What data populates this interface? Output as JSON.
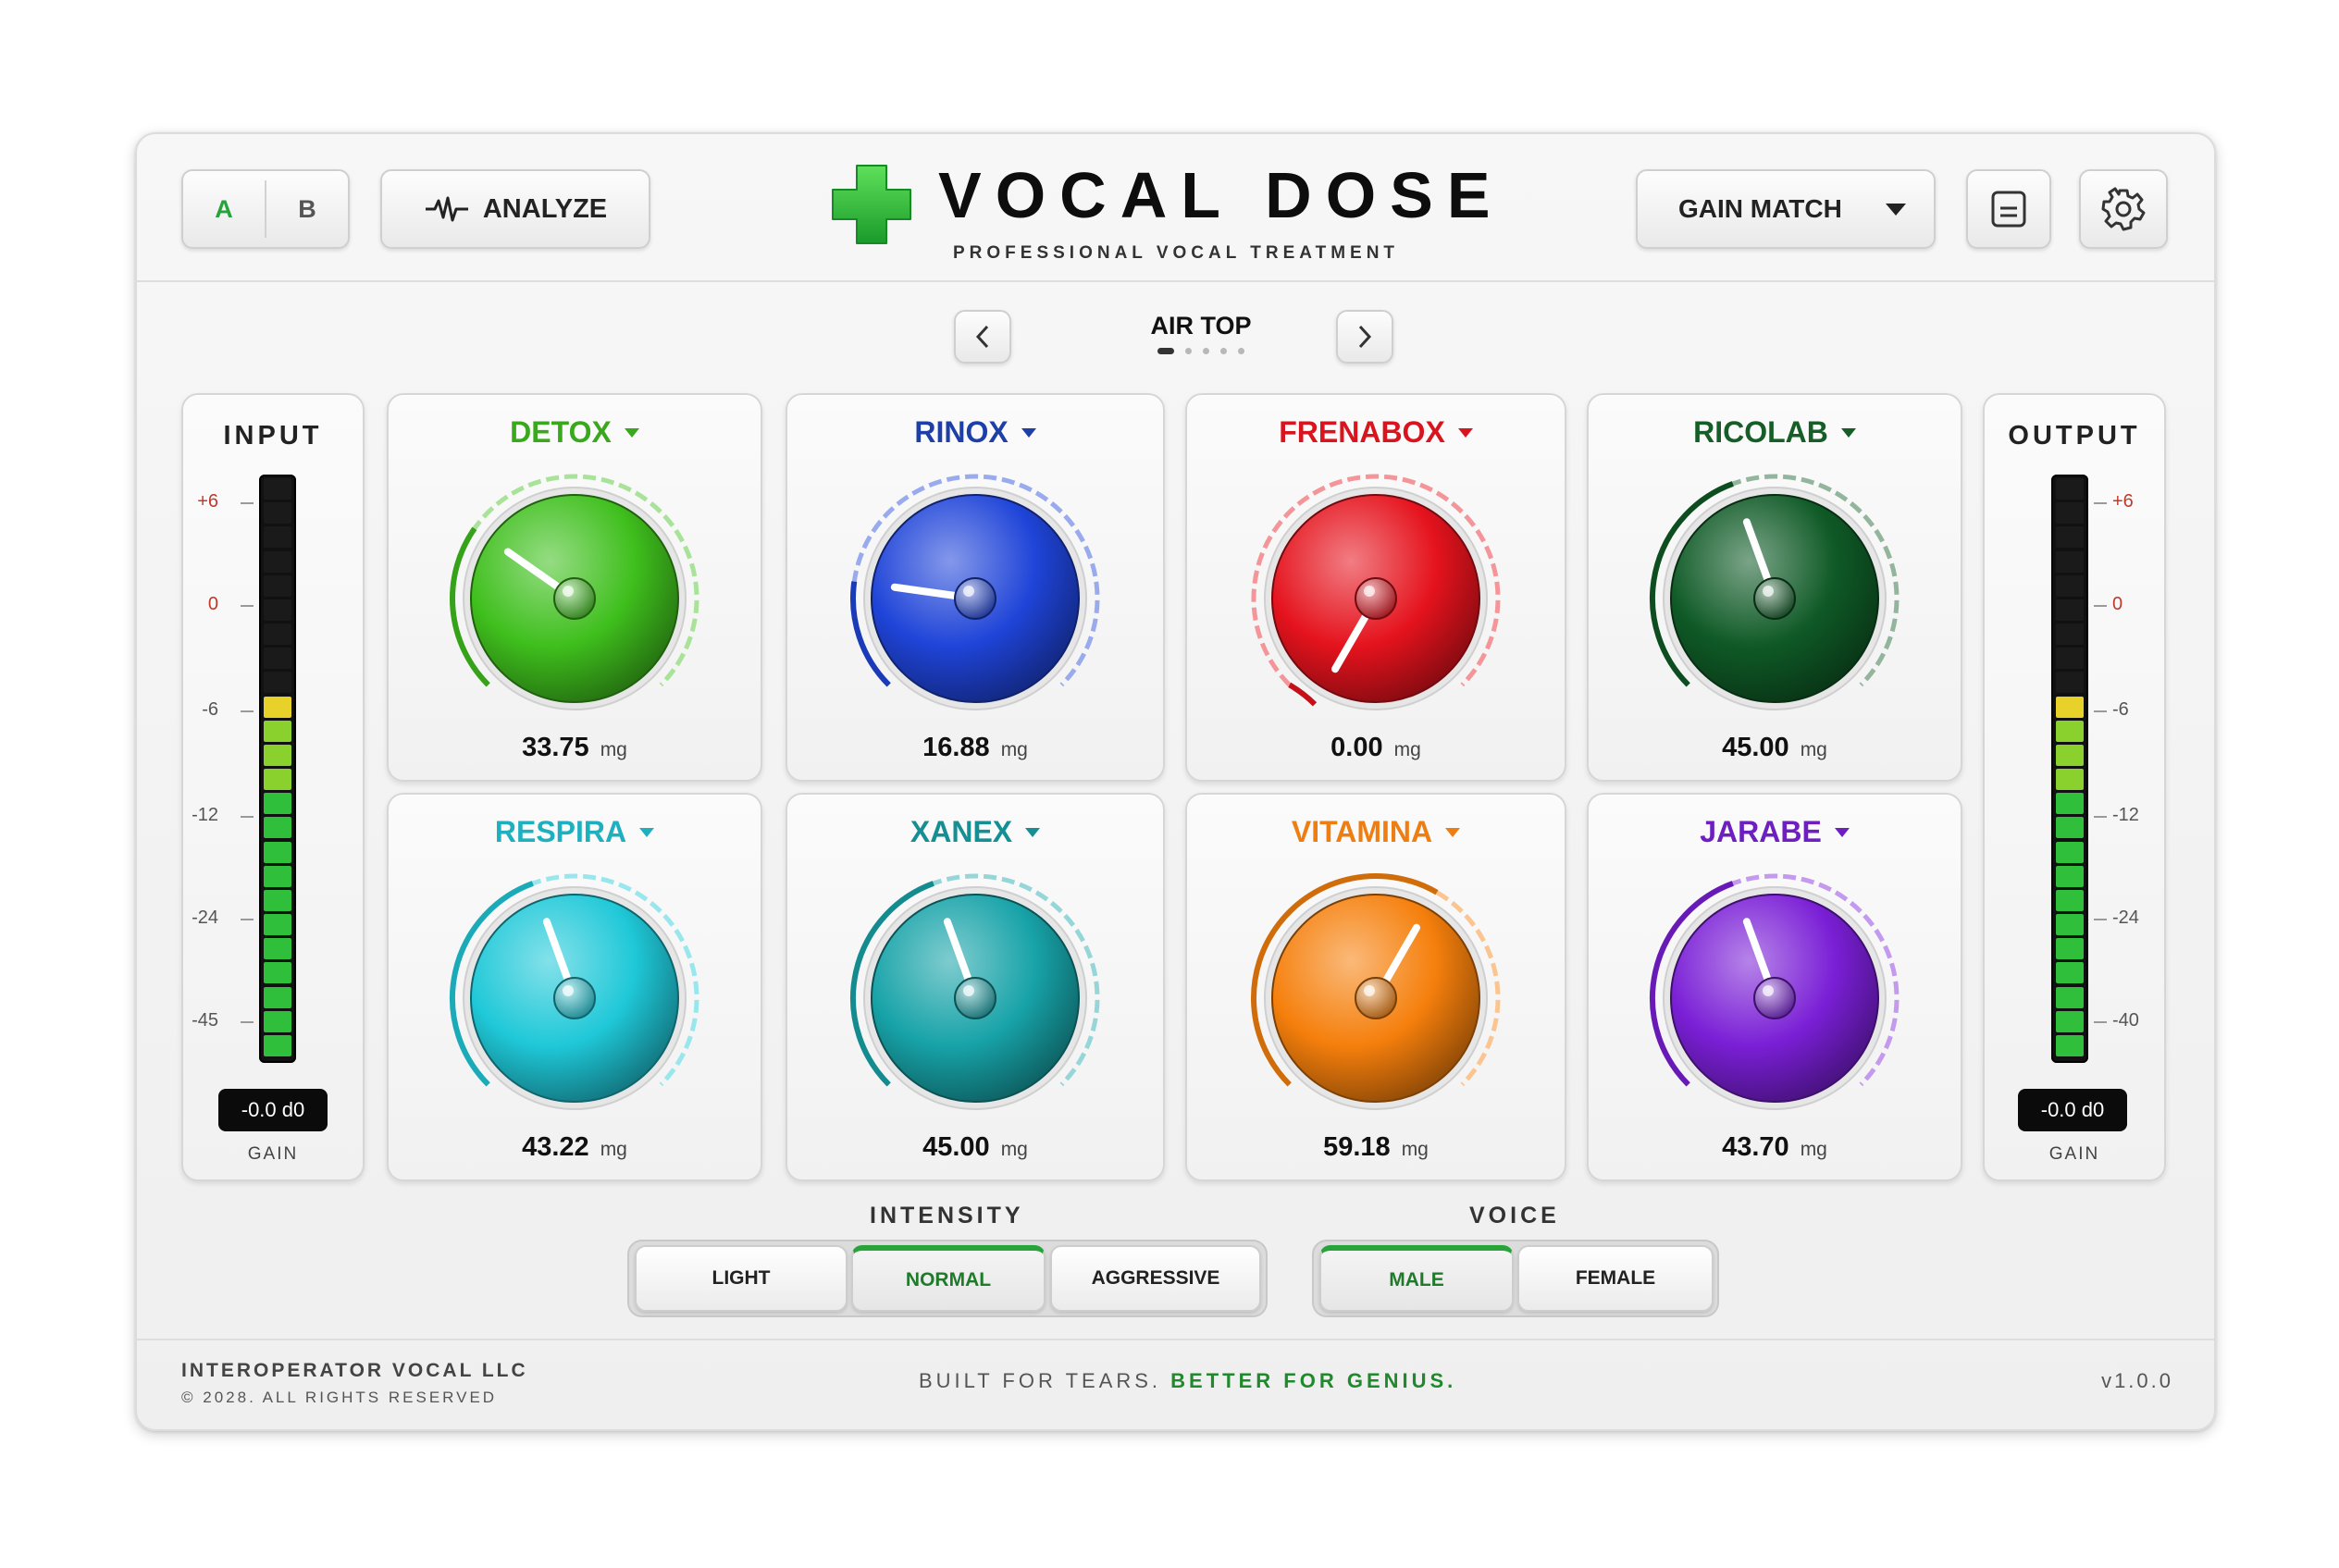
{
  "header": {
    "ab": {
      "a_label": "A",
      "b_label": "B",
      "active": "A"
    },
    "analyze_label": "ANALYZE",
    "title": "VOCAL DOSE",
    "subtitle": "PROFESSIONAL VOCAL TREATMENT",
    "gain_match_label": "GAIN MATCH"
  },
  "preset": {
    "name": "AIR TOP",
    "count": 5,
    "active_index": 0
  },
  "input": {
    "title": "INPUT",
    "scale": [
      "+6",
      "0",
      "-6",
      "-12",
      "-24",
      "-45"
    ],
    "gain_value": "-0.0 d0",
    "gain_label": "GAIN",
    "level": 0.63
  },
  "output": {
    "title": "OUTPUT",
    "scale": [
      "+6",
      "0",
      "-6",
      "-12",
      "-24",
      "-40"
    ],
    "gain_value": "-0.0 d0",
    "gain_label": "GAIN",
    "level": 0.62
  },
  "knobs": [
    {
      "name": "DETOX",
      "value": "33.75",
      "unit": "mg",
      "color": "#3fbf1d",
      "label_color": "#3aa81c"
    },
    {
      "name": "RINOX",
      "value": "16.88",
      "unit": "mg",
      "color": "#1f44d8",
      "label_color": "#1f3fa8"
    },
    {
      "name": "FRENABOX",
      "value": "0.00",
      "unit": "mg",
      "color": "#e5131d",
      "label_color": "#d8151e"
    },
    {
      "name": "RICOLAB",
      "value": "45.00",
      "unit": "mg",
      "color": "#0f5a26",
      "label_color": "#165d27"
    },
    {
      "name": "RESPIRA",
      "value": "43.22",
      "unit": "mg",
      "color": "#1fc8d8",
      "label_color": "#1fb0c0"
    },
    {
      "name": "XANEX",
      "value": "45.00",
      "unit": "mg",
      "color": "#17a3a8",
      "label_color": "#168f94"
    },
    {
      "name": "VITAMINA",
      "value": "59.18",
      "unit": "mg",
      "color": "#f57f0c",
      "label_color": "#ee7e12"
    },
    {
      "name": "JARABE",
      "value": "43.70",
      "unit": "mg",
      "color": "#7a1fd6",
      "label_color": "#6d1fc0"
    }
  ],
  "intensity": {
    "label": "INTENSITY",
    "options": [
      "LIGHT",
      "NORMAL",
      "AGGRESSIVE"
    ],
    "selected": "NORMAL"
  },
  "voice": {
    "label": "VOICE",
    "options": [
      "MALE",
      "FEMALE"
    ],
    "selected": "MALE"
  },
  "footer": {
    "company": "INTEROPERATOR VOCAL LLC",
    "copyright": "© 2028. ALL RIGHTS RESERVED",
    "tagline_a": "BUILT FOR TEARS.",
    "tagline_b": "BETTER FOR GENIUS.",
    "version": "v1.0.0"
  }
}
